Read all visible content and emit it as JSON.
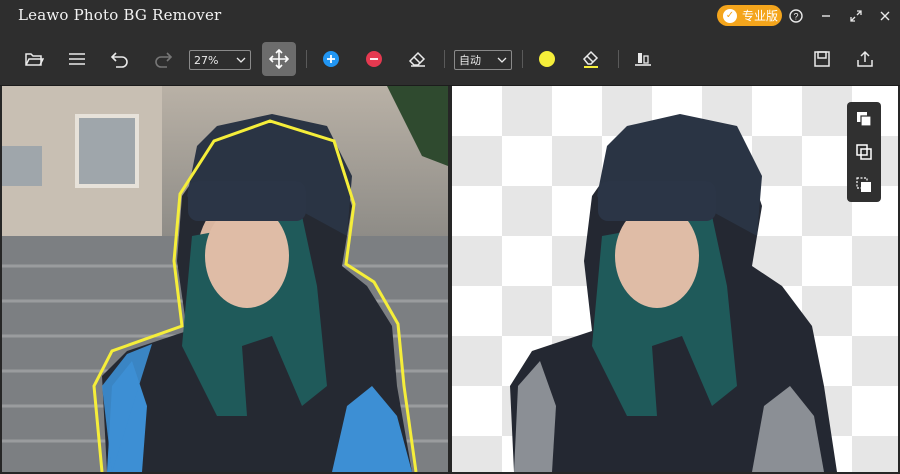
{
  "app": {
    "title": "Leawo Photo BG Remover",
    "pro_label": "专业版",
    "accent": "#f4a51c",
    "window_buttons": [
      "help-icon",
      "minimize-icon",
      "maximize-icon",
      "close-icon"
    ]
  },
  "toolbar": {
    "zoom_value": "27%",
    "mode_value": "自动",
    "tools": [
      "folder-icon",
      "menu-icon",
      "undo-icon",
      "redo-icon",
      "zoom-select",
      "move-icon",
      "add-mark-icon",
      "remove-mark-icon",
      "eraser-icon",
      "mode-select",
      "brush-color-icon",
      "erase-color-icon",
      "align-bottom-icon",
      "save-icon",
      "export-icon"
    ],
    "active_tool": "move-icon",
    "colors": {
      "keep": "#2196f3",
      "remove": "#e53950",
      "brush": "#f5ee3a",
      "highlight": "#f5ee3a"
    }
  },
  "preview": {
    "left_label": "",
    "right_label": "",
    "side_tools": [
      "copy-front-icon",
      "copy-back-icon",
      "layers-icon"
    ]
  }
}
